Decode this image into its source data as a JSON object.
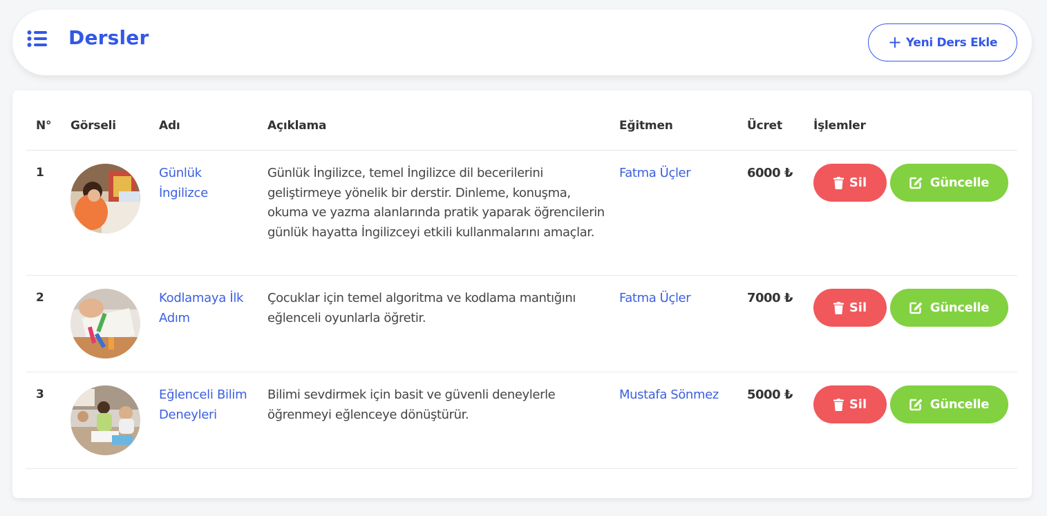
{
  "header": {
    "menu_icon": "list-icon",
    "title": "Dersler",
    "add_button_label": "Yeni Ders Ekle",
    "accent_color": "#3358e6"
  },
  "table": {
    "columns": [
      "N°",
      "Görseli",
      "Adı",
      "Açıklama",
      "Eğitmen",
      "Ücret",
      "İşlemler"
    ],
    "rows": [
      {
        "no": "1",
        "image": "child-drawing-photo",
        "name": "Günlük İngilizce",
        "description": "Günlük İngilizce, temel İngilizce dil becerilerini geliştirmeye yönelik bir derstir. Dinleme, konuşma, okuma ve yazma alanlarında pratik yaparak öğrencilerin günlük hayatta İngilizceyi etkili kullanmalarını amaçlar.",
        "teacher": "Fatma Üçler",
        "price": "6000 ₺"
      },
      {
        "no": "2",
        "image": "child-crafting-photo",
        "name": "Kodlamaya İlk Adım",
        "description": "Çocuklar için temel algoritma ve kodlama mantığını eğlenceli oyunlarla öğretir.",
        "teacher": "Fatma Üçler",
        "price": "7000 ₺"
      },
      {
        "no": "3",
        "image": "classroom-children-photo",
        "name": "Eğlenceli Bilim Deneyleri",
        "description": "Bilimi sevdirmek için basit ve güvenli deneylerle öğrenmeyi eğlenceye dönüştürür.",
        "teacher": "Mustafa Sönmez",
        "price": "5000 ₺"
      }
    ],
    "delete_label": "Sil",
    "delete_icon": "trash-icon",
    "delete_color": "#f0585c",
    "update_label": "Güncelle",
    "update_icon": "edit-icon",
    "update_color": "#82d141"
  }
}
